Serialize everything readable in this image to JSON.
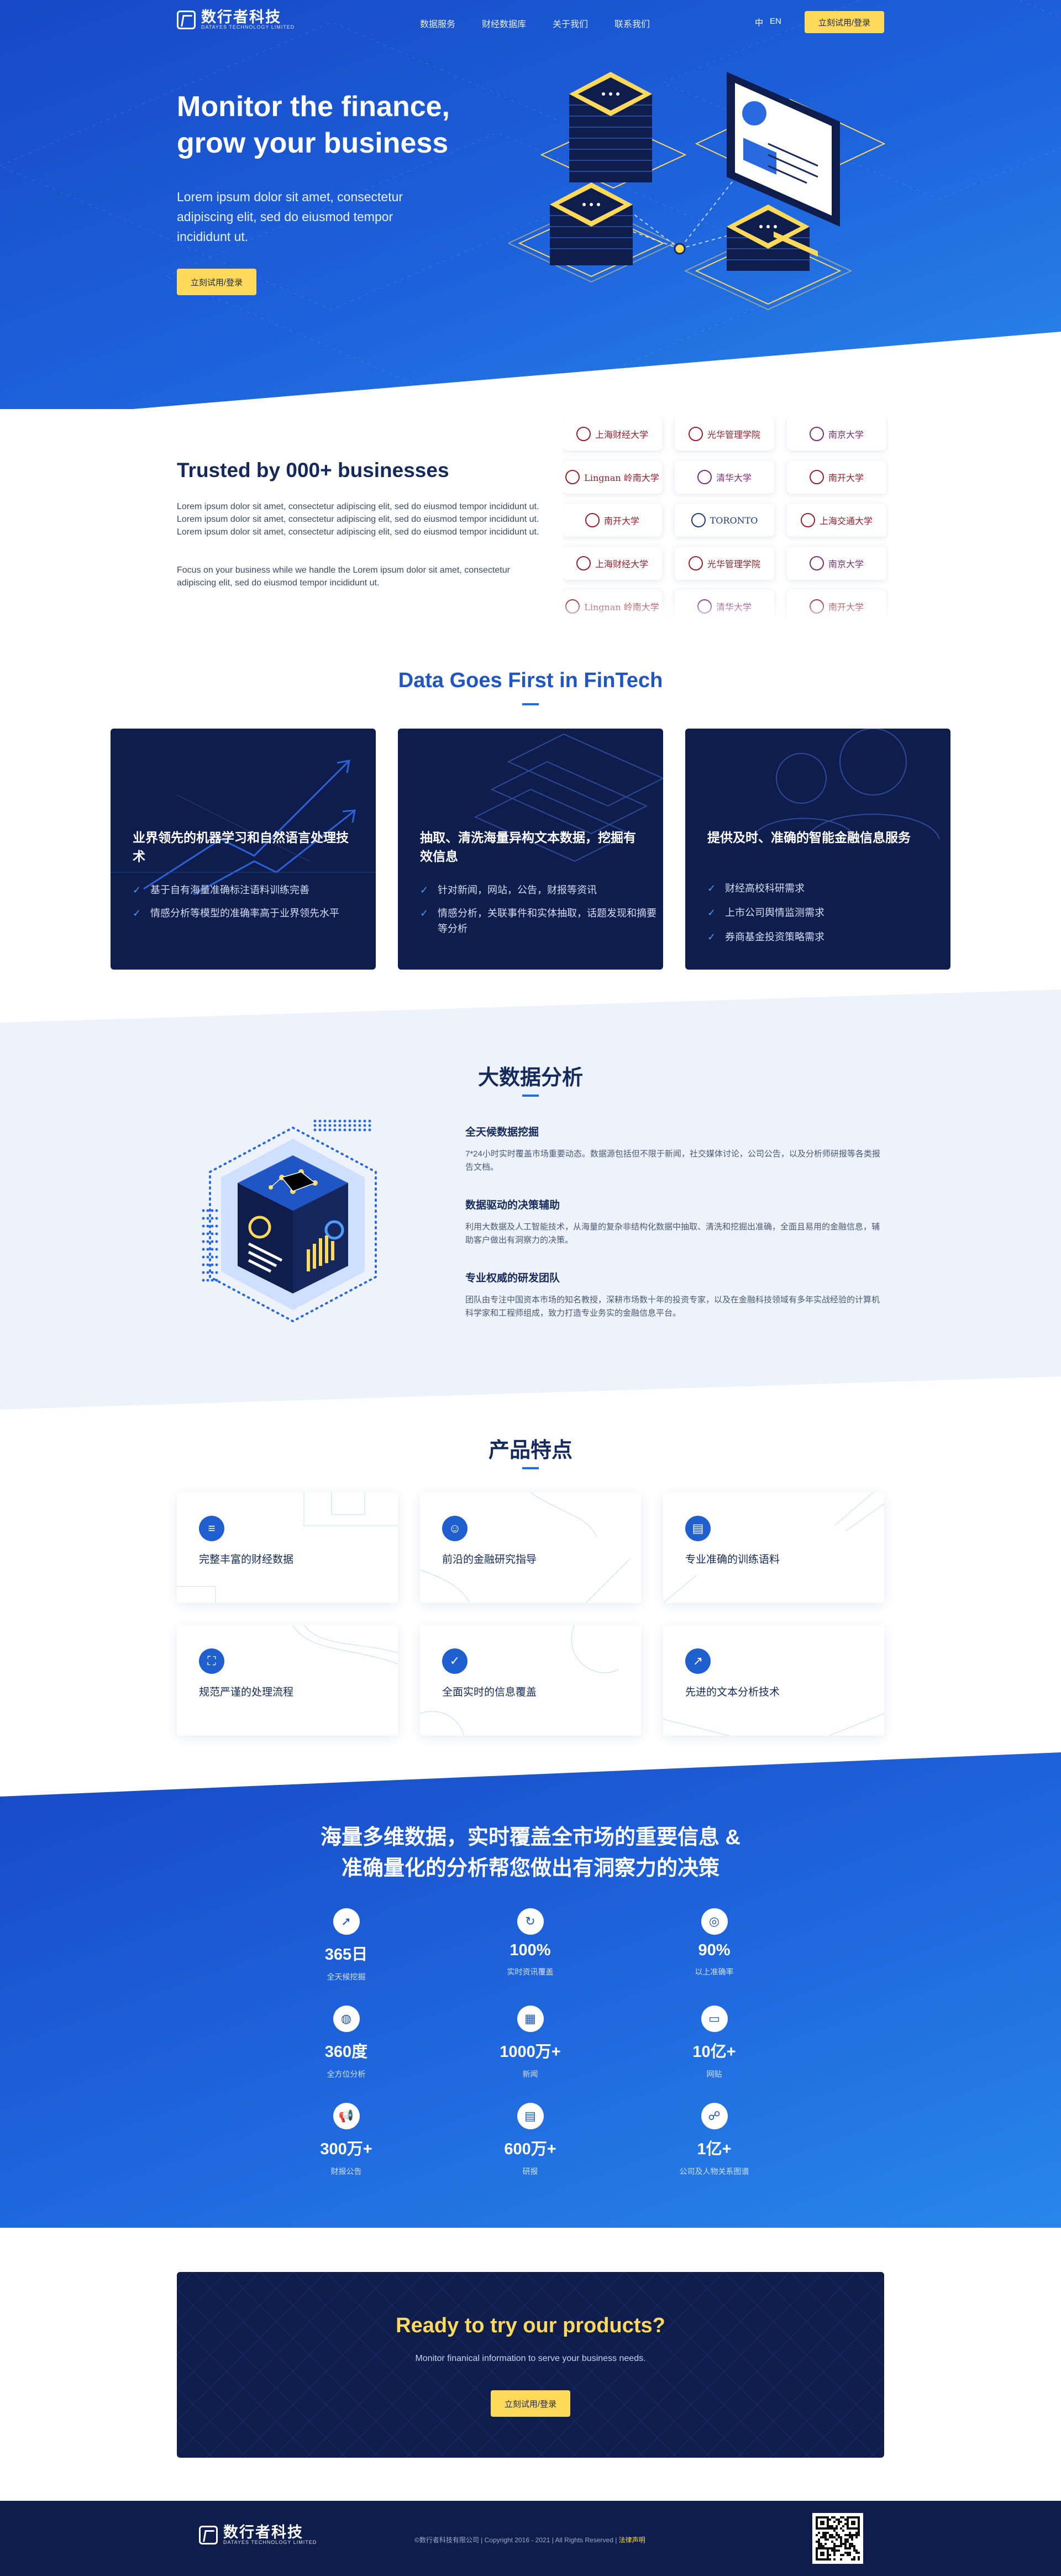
{
  "nav": {
    "logo_cn": "数行者科技",
    "logo_en": "DATAYES TECHNOLOGY LIMITED",
    "links": [
      "数据服务",
      "财经数据库",
      "关于我们",
      "联系我们"
    ],
    "lang_cn": "中",
    "lang_en": "EN",
    "cta": "立刻试用/登录"
  },
  "hero": {
    "title": "Monitor the finance, grow your business",
    "subtitle": "Lorem ipsum dolor sit amet, consectetur adipiscing elit, sed do eiusmod tempor incididunt ut.",
    "cta": "立刻试用/登录"
  },
  "trusted": {
    "title": "Trusted by 000+ businesses",
    "p1": "Lorem ipsum dolor sit amet, consectetur adipiscing elit, sed do eiusmod tempor incididunt ut. Lorem ipsum dolor sit amet, consectetur adipiscing elit, sed do eiusmod tempor incididunt ut. Lorem ipsum dolor sit amet, consectetur adipiscing elit, sed do eiusmod tempor incididunt ut.",
    "p2": "Focus on your business while we handle the Lorem ipsum dolor sit amet, consectetur adipiscing elit, sed do eiusmod tempor incididunt ut.",
    "logos": [
      {
        "name": "上海财经大学",
        "tone": "r"
      },
      {
        "name": "光华管理学院",
        "tone": "r"
      },
      {
        "name": "南京大学",
        "tone": "p"
      },
      {
        "name": "Lingnan 岭南大学",
        "tone": "r"
      },
      {
        "name": "清华大学",
        "tone": "p"
      },
      {
        "name": "南开大学",
        "tone": "r"
      },
      {
        "name": "南开大学",
        "tone": "r"
      },
      {
        "name": "TORONTO",
        "tone": "b"
      },
      {
        "name": "上海交通大学",
        "tone": "r"
      },
      {
        "name": "上海财经大学",
        "tone": "r"
      },
      {
        "name": "光华管理学院",
        "tone": "r"
      },
      {
        "name": "南京大学",
        "tone": "p"
      },
      {
        "name": "Lingnan 岭南大学",
        "tone": "r"
      },
      {
        "name": "清华大学",
        "tone": "p"
      },
      {
        "name": "南开大学",
        "tone": "r"
      }
    ]
  },
  "datafirst": {
    "title": "Data Goes First in FinTech",
    "cards": [
      {
        "title": "业界领先的机器学习和自然语言处理技术",
        "items": [
          "基于自有海量准确标注语料训练完善",
          "情感分析等模型的准确率高于业界领先水平"
        ]
      },
      {
        "title": "抽取、清洗海量异构文本数据，挖掘有效信息",
        "items": [
          "针对新闻，网站，公告，财报等资讯",
          "情感分析，关联事件和实体抽取，话题发现和摘要等分析"
        ]
      },
      {
        "title": "提供及时、准确的智能金融信息服务",
        "items": [
          "财经高校科研需求",
          "上市公司舆情监测需求",
          "券商基金投资策略需求"
        ]
      }
    ]
  },
  "bigdata": {
    "title": "大数据分析",
    "items": [
      {
        "title": "全天候数据挖掘",
        "text": "7*24小时实时覆盖市场重要动态。数据源包括但不限于新闻，社交媒体讨论，公司公告，以及分析师研报等各类报告文档。"
      },
      {
        "title": "数据驱动的决策辅助",
        "text": "利用大数据及人工智能技术，从海量的复杂非结构化数据中抽取、清洗和挖掘出准确，全面且易用的金融信息，辅助客户做出有洞察力的决策。"
      },
      {
        "title": "专业权威的研发团队",
        "text": "团队由专注中国资本市场的知名教授，深耕市场数十年的投资专家，以及在金融科技领域有多年实战经验的计算机科学家和工程师组成，致力打造专业务实的金融信息平台。"
      }
    ]
  },
  "features": {
    "title": "产品特点",
    "items": [
      {
        "label": "完整丰富的财经数据",
        "icon": "database-icon",
        "glyph": "≡"
      },
      {
        "label": "前沿的金融研究指导",
        "icon": "user-research-icon",
        "glyph": "☺"
      },
      {
        "label": "专业准确的训练语料",
        "icon": "document-icon",
        "glyph": "▤"
      },
      {
        "label": "规范严谨的处理流程",
        "icon": "flow-icon",
        "glyph": "⛶"
      },
      {
        "label": "全面实时的信息覆盖",
        "icon": "check-circle-icon",
        "glyph": "✓"
      },
      {
        "label": "先进的文本分析技术",
        "icon": "trend-chart-icon",
        "glyph": "↗"
      }
    ]
  },
  "stats": {
    "title_line1": "海量多维数据，实时覆盖全市场的重要信息 &",
    "title_line2": "准确量化的分析帮您做出有洞察力的决策",
    "items": [
      {
        "value": "365日",
        "label": "全天候挖掘",
        "icon": "compass-icon",
        "glyph": "➚"
      },
      {
        "value": "100%",
        "label": "实时资讯覆盖",
        "icon": "refresh-icon",
        "glyph": "↻"
      },
      {
        "value": "90%",
        "label": "以上准确率",
        "icon": "target-icon",
        "glyph": "◎"
      },
      {
        "value": "360度",
        "label": "全方位分析",
        "icon": "globe-icon",
        "glyph": "◍"
      },
      {
        "value": "1000万+",
        "label": "新闻",
        "icon": "news-icon",
        "glyph": "▦"
      },
      {
        "value": "10亿+",
        "label": "网贴",
        "icon": "post-icon",
        "glyph": "▭"
      },
      {
        "value": "300万+",
        "label": "财报公告",
        "icon": "megaphone-icon",
        "glyph": "📢"
      },
      {
        "value": "600万+",
        "label": "研报",
        "icon": "report-icon",
        "glyph": "▤"
      },
      {
        "value": "1亿+",
        "label": "公司及人物关系图谱",
        "icon": "relation-graph-icon",
        "glyph": "☍"
      }
    ]
  },
  "cta": {
    "title": "Ready to try our products?",
    "subtitle": "Monitor finanical information to serve your business needs.",
    "button": "立刻试用/登录"
  },
  "footer": {
    "logo_cn": "数行者科技",
    "logo_en": "DATAYES TECHNOLOGY LIMITED",
    "copyright": "©数行者科技有限公司 | Copyright 2016 - 2021 | All Rights Reserved |",
    "link": "法律声明"
  },
  "colors": {
    "primary": "#1f55c4",
    "dark": "#0f1d4d",
    "accent": "#ffd95a"
  }
}
